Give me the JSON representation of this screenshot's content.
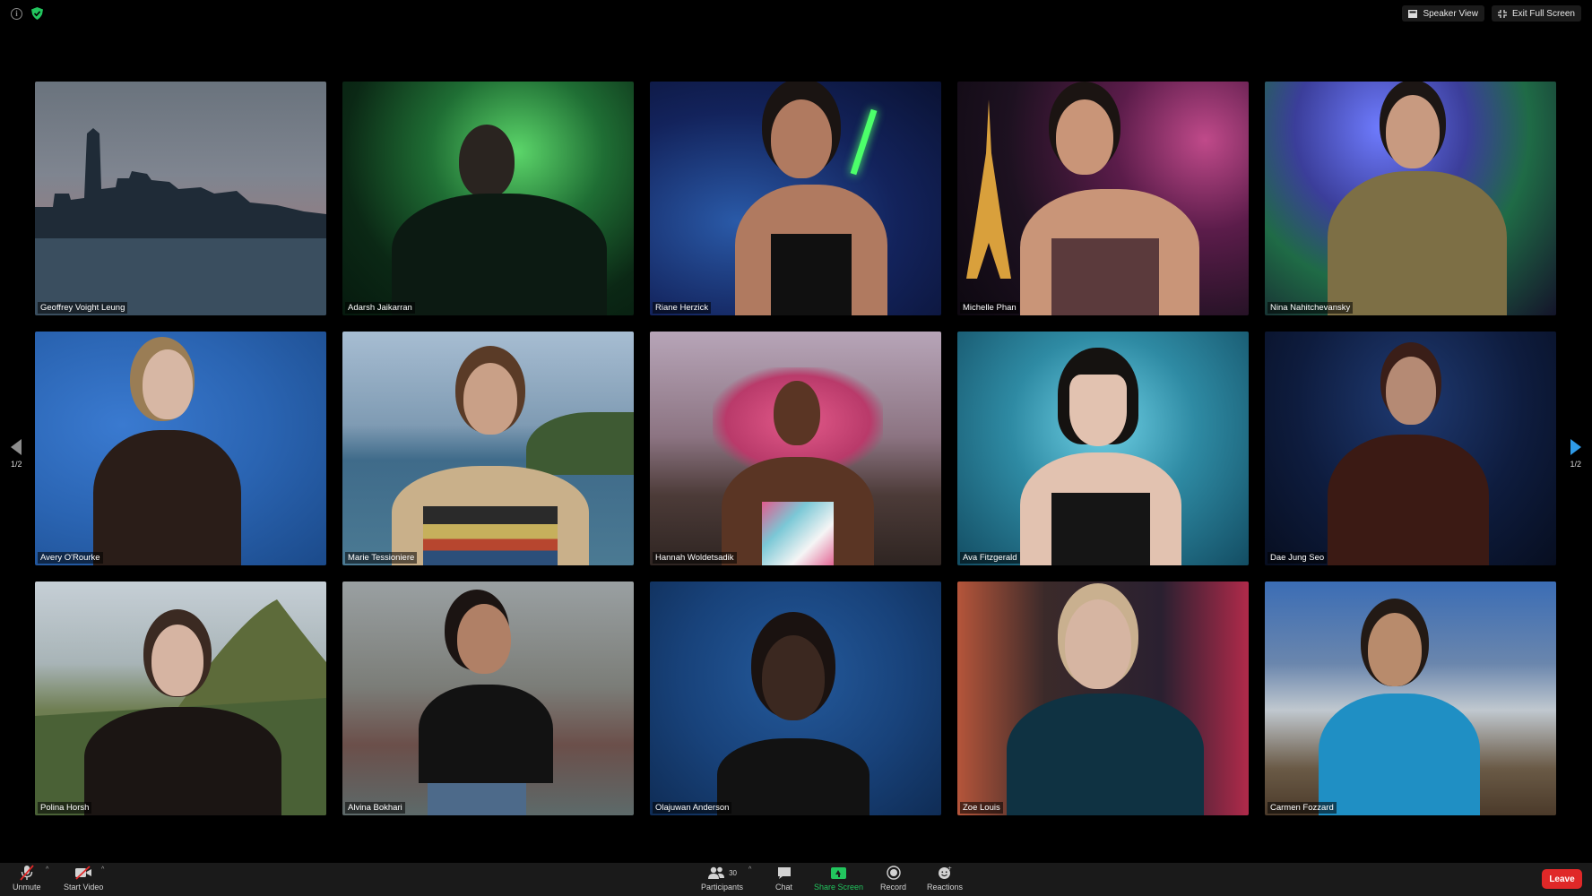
{
  "top_right": {
    "speaker_view": "Speaker View",
    "exit_full_screen": "Exit Full Screen"
  },
  "pagination": {
    "left": "1/2",
    "right": "1/2"
  },
  "participants": [
    {
      "name": "Geoffrey Voight Leung",
      "bg": "#55616e"
    },
    {
      "name": "Adarsh Jaikarran",
      "bg": "#0e2a19"
    },
    {
      "name": "Riane Herzick",
      "bg": "#13235c"
    },
    {
      "name": "Michelle Phan",
      "bg": "#1d1120"
    },
    {
      "name": "Nina Nahitchevansky",
      "bg": "#2a2a56"
    },
    {
      "name": "Avery O'Rourke",
      "bg": "#2a64b2"
    },
    {
      "name": "Marie Tessioniere",
      "bg": "#7f9bb3"
    },
    {
      "name": "Hannah Woldetsadik",
      "bg": "#7e5d66"
    },
    {
      "name": "Ava Fitzgerald",
      "bg": "#2e8aa3"
    },
    {
      "name": "Dae Jung Seo",
      "bg": "#0e1c3e"
    },
    {
      "name": "Polina Horsh",
      "bg": "#8d9a8a"
    },
    {
      "name": "Alvina Bokhari",
      "bg": "#7b7d78"
    },
    {
      "name": "Olajuwan Anderson",
      "bg": "#18427a"
    },
    {
      "name": "Zoe Louis",
      "bg": "#3b2a2a"
    },
    {
      "name": "Carmen Fozzard",
      "bg": "#6a86ad"
    }
  ],
  "toolbar": {
    "unmute": "Unmute",
    "start_video": "Start Video",
    "participants": "Participants",
    "participant_count": "30",
    "chat": "Chat",
    "share_screen": "Share Screen",
    "record": "Record",
    "reactions": "Reactions",
    "leave": "Leave"
  },
  "colors": {
    "share_green": "#22c55e",
    "leave_red": "#e02828",
    "toolbar_bg": "#1a1a1a",
    "arrow_blue": "#2f9be8"
  }
}
